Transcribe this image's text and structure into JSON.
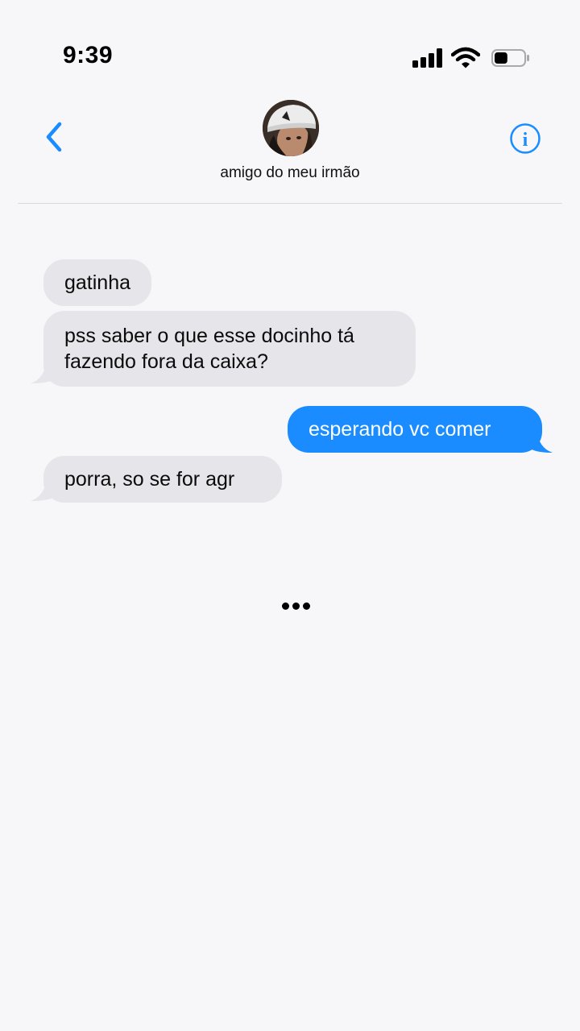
{
  "status_bar": {
    "time": "9:39",
    "signal_icon": "cellular-signal-icon",
    "wifi_icon": "wifi-icon",
    "battery_icon": "battery-icon",
    "battery_level": 0.45
  },
  "header": {
    "contact_name": "amigo do meu irmão",
    "back_icon": "chevron-left-icon",
    "info_icon": "info-circle-icon",
    "accent_color": "#1a8cff"
  },
  "messages": [
    {
      "direction": "incoming",
      "text": "gatinha"
    },
    {
      "direction": "incoming",
      "lines": [
        "pss saber o que esse docinho tá",
        "fazendo fora da caixa?"
      ]
    },
    {
      "direction": "outgoing",
      "text": "esperando vc comer"
    },
    {
      "direction": "incoming",
      "text": "porra, so se for agr"
    }
  ],
  "typing_indicator": "typing-dots-icon",
  "colors": {
    "incoming_bubble": "#e5e5ea",
    "outgoing_bubble": "#1a8cff",
    "background": "#f7f7f9"
  }
}
